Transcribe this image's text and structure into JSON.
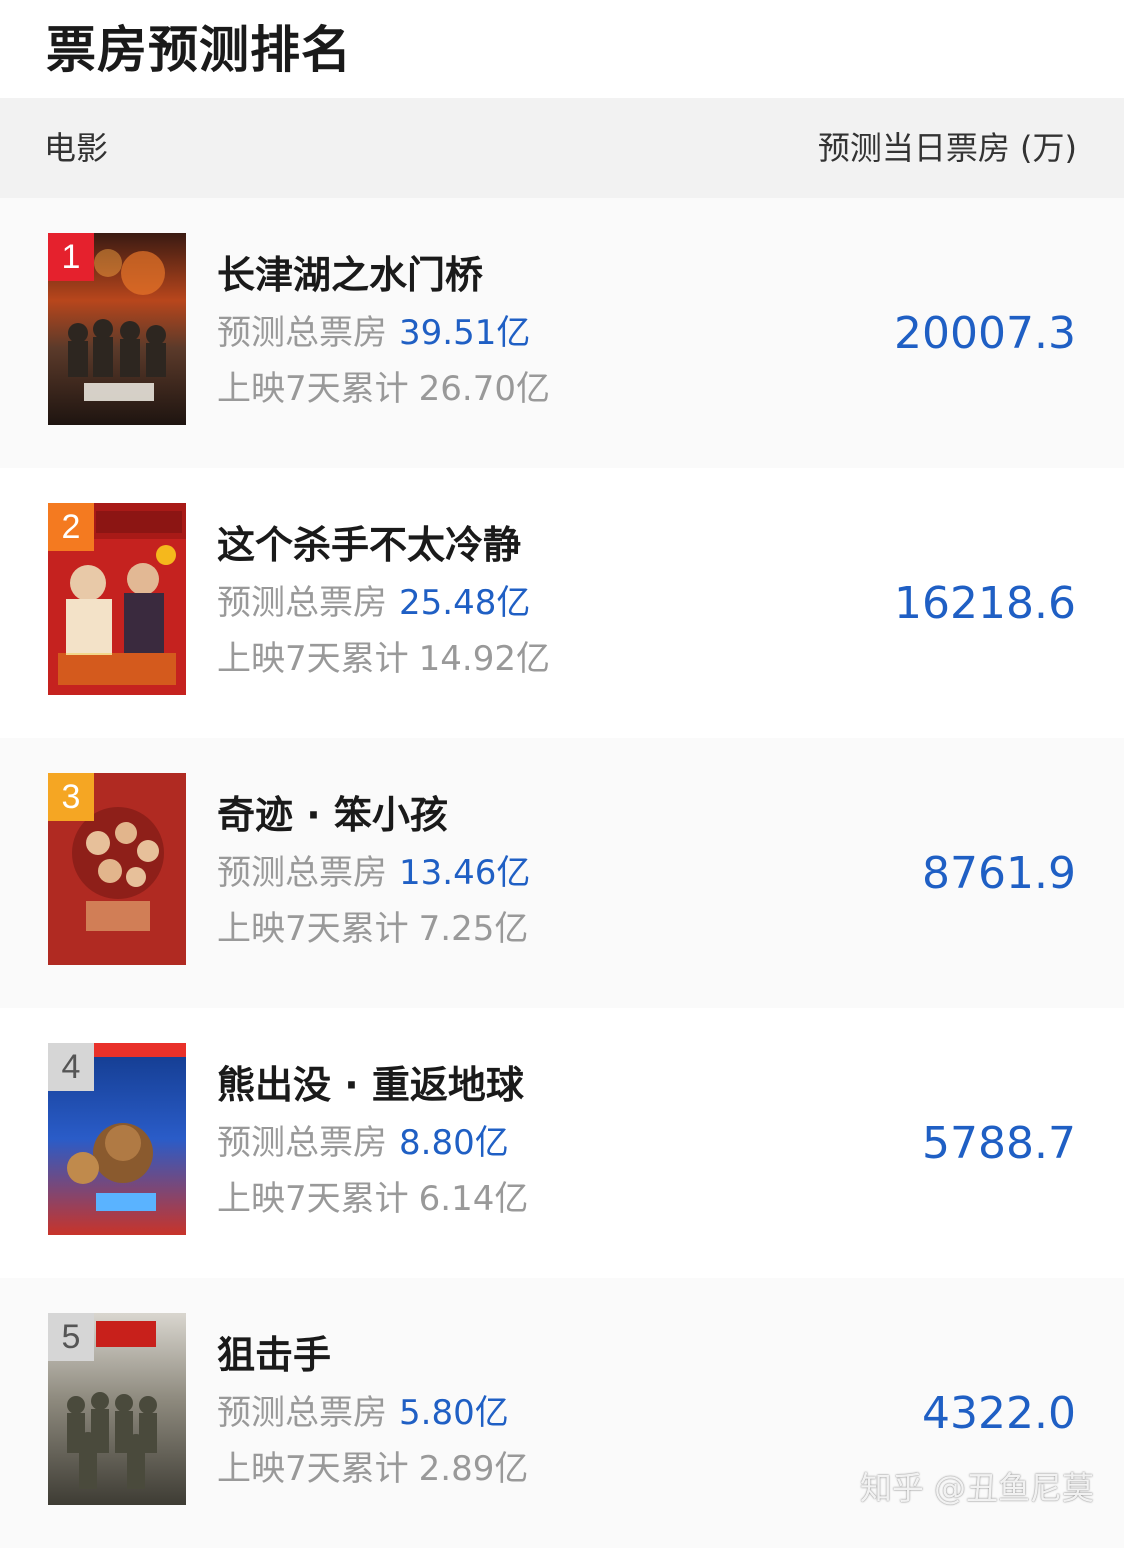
{
  "page_title": "票房预测排名",
  "header": {
    "left_label": "电影",
    "right_label": "预测当日票房 (万)"
  },
  "labels": {
    "predicted_total": "预测总票房",
    "cumulative": "上映7天累计"
  },
  "movies": [
    {
      "rank": "1",
      "rank_color": "#e5212d",
      "poster_icon": "war-movie-poster-icon",
      "title": "长津湖之水门桥",
      "predicted_total": "39.51亿",
      "cumulative": "26.70亿",
      "daily": "20007.3"
    },
    {
      "rank": "2",
      "rank_color": "#f47a20",
      "poster_icon": "comedy-movie-poster-icon",
      "title": "这个杀手不太冷静",
      "predicted_total": "25.48亿",
      "cumulative": "14.92亿",
      "daily": "16218.6"
    },
    {
      "rank": "3",
      "rank_color": "#f5a623",
      "poster_icon": "family-movie-poster-icon",
      "title": "奇迹 · 笨小孩",
      "predicted_total": "13.46亿",
      "cumulative": "7.25亿",
      "daily": "8761.9"
    },
    {
      "rank": "4",
      "rank_color": "#d6d6d6",
      "poster_icon": "animation-movie-poster-icon",
      "title": "熊出没 · 重返地球",
      "predicted_total": "8.80亿",
      "cumulative": "6.14亿",
      "daily": "5788.7"
    },
    {
      "rank": "5",
      "rank_color": "#d6d6d6",
      "poster_icon": "sniper-movie-poster-icon",
      "title": "狙击手",
      "predicted_total": "5.80亿",
      "cumulative": "2.89亿",
      "daily": "4322.0"
    }
  ],
  "watermark": "知乎 @丑鱼尼莫",
  "colors": {
    "accent_blue": "#1f5fc4",
    "muted_text": "#999999",
    "header_bg": "#f2f2f2"
  }
}
